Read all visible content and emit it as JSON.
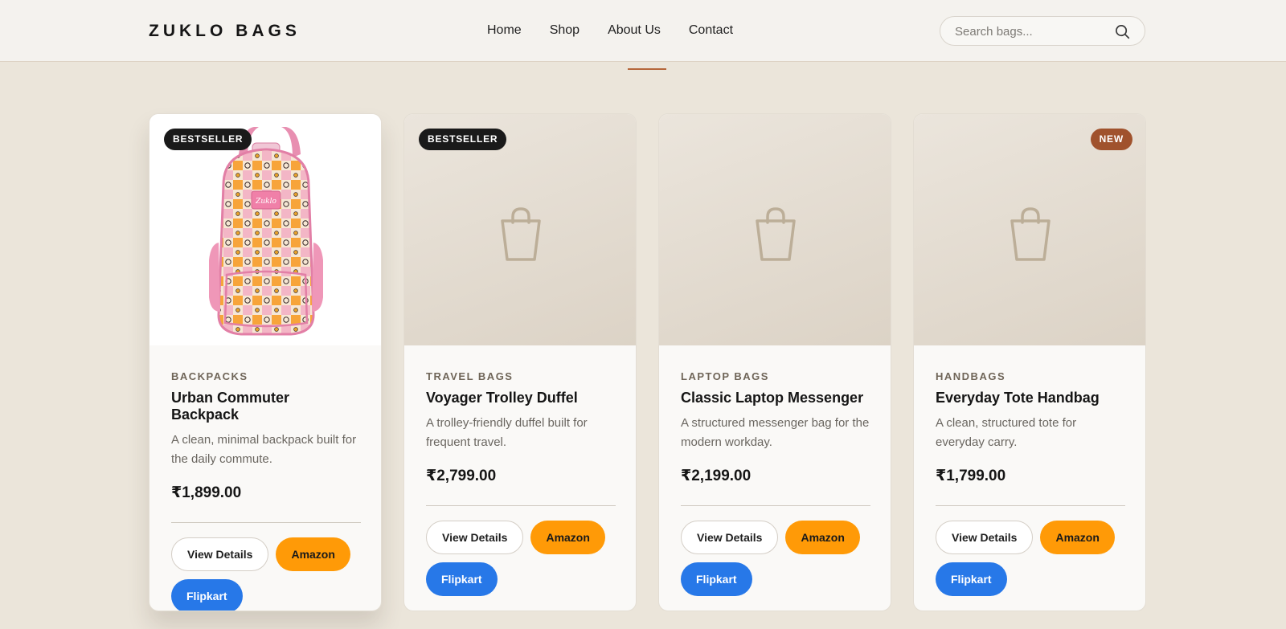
{
  "header": {
    "logo": "ZUKLO BAGS",
    "nav": [
      "Home",
      "Shop",
      "About Us",
      "Contact"
    ],
    "search_placeholder": "Search bags..."
  },
  "products": [
    {
      "badge": "BESTSELLER",
      "category": "BACKPACKS",
      "name": "Urban Commuter Backpack",
      "description": "A clean, minimal backpack built for the daily commute.",
      "price": "₹1,899.00",
      "buttons": {
        "details": "View Details",
        "amazon": "Amazon",
        "flipkart": "Flipkart"
      }
    },
    {
      "badge": "BESTSELLER",
      "category": "TRAVEL BAGS",
      "name": "Voyager Trolley Duffel",
      "description": "A trolley-friendly duffel built for frequent travel.",
      "price": "₹2,799.00",
      "buttons": {
        "details": "View Details",
        "amazon": "Amazon",
        "flipkart": "Flipkart"
      }
    },
    {
      "badge": "",
      "category": "LAPTOP BAGS",
      "name": "Classic Laptop Messenger",
      "description": "A structured messenger bag for the modern workday.",
      "price": "₹2,199.00",
      "buttons": {
        "details": "View Details",
        "amazon": "Amazon",
        "flipkart": "Flipkart"
      }
    },
    {
      "badge": "NEW",
      "category": "HANDBAGS",
      "name": "Everyday Tote Handbag",
      "description": "A clean, structured tote for everyday carry.",
      "price": "₹1,799.00",
      "buttons": {
        "details": "View Details",
        "amazon": "Amazon",
        "flipkart": "Flipkart"
      }
    }
  ],
  "icons": {
    "search": "search-icon",
    "placeholder": "shopping-bag-icon"
  },
  "colors": {
    "accent": "#b5663a",
    "amazon": "#ff9a07",
    "flipkart": "#2778e8",
    "badge_dark": "#1a1a1a",
    "badge_new": "#a0522d"
  }
}
